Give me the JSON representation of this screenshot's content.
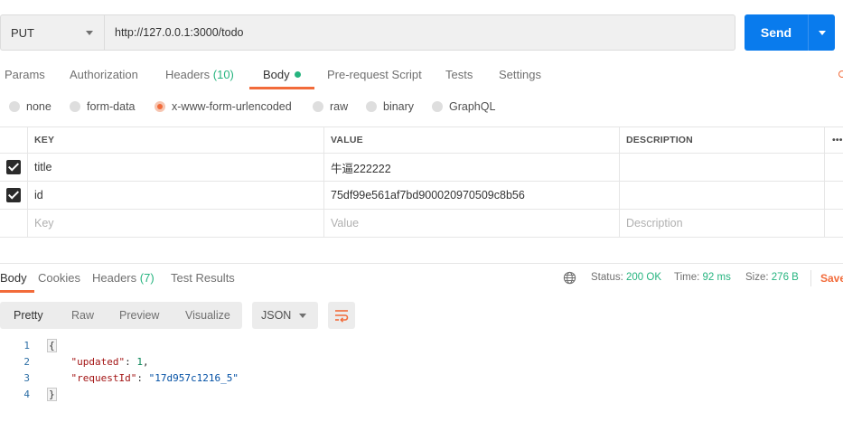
{
  "request": {
    "method": "PUT",
    "url": "http://127.0.0.1:3000/todo",
    "send_label": "Send"
  },
  "request_tabs": [
    {
      "label": "Params"
    },
    {
      "label": "Authorization"
    },
    {
      "label": "Headers",
      "count": "(10)"
    },
    {
      "label": "Body",
      "active": true
    },
    {
      "label": "Pre-request Script"
    },
    {
      "label": "Tests"
    },
    {
      "label": "Settings"
    }
  ],
  "body_types": [
    {
      "label": "none"
    },
    {
      "label": "form-data"
    },
    {
      "label": "x-www-form-urlencoded",
      "selected": true
    },
    {
      "label": "raw"
    },
    {
      "label": "binary"
    },
    {
      "label": "GraphQL"
    }
  ],
  "params_table": {
    "headers": {
      "key": "KEY",
      "value": "VALUE",
      "description": "DESCRIPTION",
      "more": "•••"
    },
    "rows": [
      {
        "checked": true,
        "key": "title",
        "value": "牛逼222222",
        "description": ""
      },
      {
        "checked": true,
        "key": "id",
        "value": "75df99e561af7bd900020970509c8b56",
        "description": ""
      }
    ],
    "placeholders": {
      "key": "Key",
      "value": "Value",
      "description": "Description"
    }
  },
  "response_tabs": [
    {
      "label": "Body",
      "active": true
    },
    {
      "label": "Cookies"
    },
    {
      "label": "Headers",
      "count": "(7)"
    },
    {
      "label": "Test Results"
    }
  ],
  "response_meta": {
    "status_label": "Status:",
    "status_value": "200 OK",
    "time_label": "Time:",
    "time_value": "92 ms",
    "size_label": "Size:",
    "size_value": "276 B",
    "save_label": "Save"
  },
  "view_modes": [
    {
      "label": "Pretty",
      "active": true
    },
    {
      "label": "Raw"
    },
    {
      "label": "Preview"
    },
    {
      "label": "Visualize"
    }
  ],
  "format": "JSON",
  "code_lines": [
    {
      "num": "1",
      "text": "{"
    },
    {
      "num": "2",
      "key": "\"updated\"",
      "value": "1",
      "value_type": "number",
      "trailing": ","
    },
    {
      "num": "3",
      "key": "\"requestId\"",
      "value": "\"17d957c1216_5\"",
      "value_type": "string",
      "trailing": ""
    },
    {
      "num": "4",
      "text": "}"
    }
  ],
  "colors": {
    "accent": "#f26b3a",
    "send_button": "#097bed",
    "success": "#26b47f"
  },
  "icons": {
    "method_dropdown": "chevron-down-icon",
    "send_dropdown": "chevron-down-icon",
    "globe": "globe-icon",
    "wrap": "wrap-lines-icon",
    "checkbox": "checkbox-checked-icon"
  }
}
